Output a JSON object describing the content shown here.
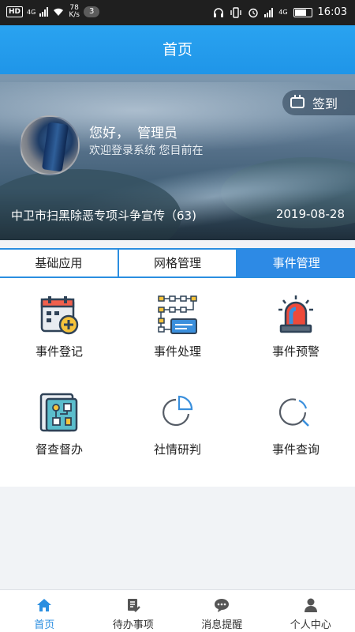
{
  "status_bar": {
    "network_hd": "HD",
    "network_type": "4G",
    "speed_value": "78",
    "speed_unit": "K/s",
    "notification_count": "3",
    "signal_type": "4G",
    "time": "16:03"
  },
  "header": {
    "title": "首页"
  },
  "banner": {
    "checkin_label": "签到",
    "greeting": "您好，",
    "username": "管理员",
    "welcome_text": "欢迎登录系统 您目前在",
    "news_title": "中卫市扫黑除恶专项斗争宣传（63)",
    "news_date": "2019-08-28"
  },
  "tabs": [
    {
      "label": "基础应用",
      "active": false
    },
    {
      "label": "网格管理",
      "active": false
    },
    {
      "label": "事件管理",
      "active": true
    }
  ],
  "features": [
    {
      "label": "事件登记",
      "icon": "calendar-add-icon"
    },
    {
      "label": "事件处理",
      "icon": "flowchart-icon"
    },
    {
      "label": "事件预警",
      "icon": "alarm-siren-icon"
    },
    {
      "label": "督查督办",
      "icon": "supervision-board-icon"
    },
    {
      "label": "社情研判",
      "icon": "pie-chart-icon"
    },
    {
      "label": "事件查询",
      "icon": "search-icon"
    }
  ],
  "bottom_nav": [
    {
      "label": "首页",
      "icon": "home-icon",
      "active": true
    },
    {
      "label": "待办事项",
      "icon": "todo-list-icon",
      "active": false
    },
    {
      "label": "消息提醒",
      "icon": "message-icon",
      "active": false
    },
    {
      "label": "个人中心",
      "icon": "user-icon",
      "active": false
    }
  ],
  "colors": {
    "primary": "#2a8ee0",
    "header": "#1f95e8",
    "status_bar": "#1f1f1f"
  }
}
